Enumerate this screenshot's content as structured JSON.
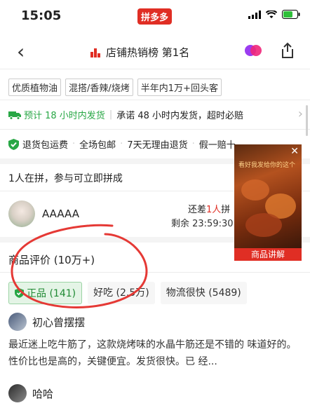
{
  "status_bar": {
    "time": "15:05",
    "app_badge": "拼多多"
  },
  "nav": {
    "back_glyph": "‹",
    "title": "店铺热销榜 第1名"
  },
  "tags": [
    "优质植物油",
    "混搭/香辣/烧烤",
    "半年内1万+回头客"
  ],
  "shipping": {
    "estimate": "预计 18 小时内发货",
    "promise": "承诺 48 小时内发货，超时必赔"
  },
  "guarantees": [
    "退货包运费",
    "全场包邮",
    "7天无理由退货",
    "假一赔十"
  ],
  "group_buy": {
    "title": "1人在拼，参与可立即拼成",
    "user_name": "AAAAA",
    "need_prefix": "还差",
    "need_count": "1人",
    "need_suffix": "拼",
    "remaining": "剩余 23:59:30"
  },
  "video": {
    "caption": "看好我发给你的这个",
    "button": "商品讲解"
  },
  "reviews": {
    "title": "商品评价 (10万+)",
    "chips": [
      {
        "label": "正品 (141)",
        "active": true
      },
      {
        "label": "好吃 (2.5万)",
        "active": false
      },
      {
        "label": "物流很快 (5489)",
        "active": false
      }
    ],
    "items": [
      {
        "user": "初心曾摆摆",
        "text": "最近迷上吃牛筋了，这款烧烤味的水晶牛筋还是不错的 味道好的。性价比也是高的，关键便宜。发货很快。已 经..."
      },
      {
        "user": "哈哈"
      }
    ]
  },
  "colors": {
    "accent": "#e02e24",
    "green": "#28a745",
    "annotation": "#e53935"
  }
}
